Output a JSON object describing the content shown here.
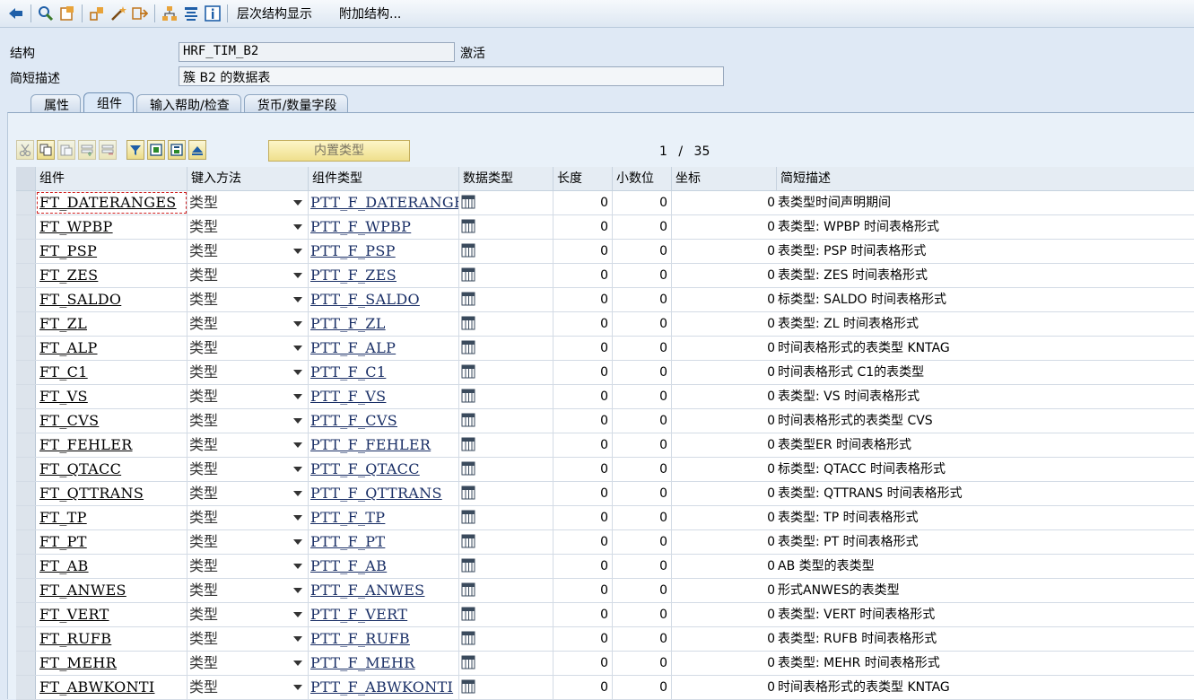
{
  "toolbar": {
    "items": [
      {
        "name": "back-icon",
        "color": "#1f5fa8"
      },
      {
        "name": "display-change-icon",
        "color": "#3a7a2a"
      },
      {
        "name": "activate-icon",
        "color": "#c0751b"
      },
      {
        "name": "where-used-icon",
        "color": "#c0751b"
      },
      {
        "name": "magic-wand-icon",
        "color": "#c0751b"
      },
      {
        "name": "object-list-icon",
        "color": "#c0751b"
      },
      {
        "name": "hierarchy-icon",
        "color": "#c0751b"
      },
      {
        "name": "other-object-icon",
        "color": "#1f5fa8"
      },
      {
        "name": "info-icon",
        "color": "#1f5fa8"
      }
    ],
    "hierarchy_label": "层次结构显示",
    "append_label": "附加结构..."
  },
  "header": {
    "structure_label": "结构",
    "structure_value": "HRF_TIM_B2",
    "status": "激活",
    "short_desc_label": "简短描述",
    "short_desc_value": "簇 B2 的数据表"
  },
  "tabs": [
    "属性",
    "组件",
    "输入帮助/检查",
    "货币/数量字段"
  ],
  "active_tab": 1,
  "grid_toolbar": {
    "builtin_type_label": "内置类型",
    "page_current": "1",
    "page_sep": "/",
    "page_total": "35"
  },
  "columns": {
    "component": "组件",
    "method": "键入方法",
    "comp_type": "组件类型",
    "data_type": "数据类型",
    "length": "长度",
    "decimals": "小数位",
    "coordinate": "坐标",
    "short_desc": "简短描述"
  },
  "rows": [
    {
      "component": "FT_DATERANGES",
      "method": "类型",
      "comp_type": "PTT_F_DATERANGES",
      "length": "0",
      "decimals": "0",
      "coordinate": "0",
      "desc": "表类型时间声明期间"
    },
    {
      "component": "FT_WPBP",
      "method": "类型",
      "comp_type": "PTT_F_WPBP",
      "length": "0",
      "decimals": "0",
      "coordinate": "0",
      "desc": "表类型: WPBP 时间表格形式"
    },
    {
      "component": "FT_PSP",
      "method": "类型",
      "comp_type": "PTT_F_PSP",
      "length": "0",
      "decimals": "0",
      "coordinate": "0",
      "desc": "表类型: PSP 时间表格形式"
    },
    {
      "component": "FT_ZES",
      "method": "类型",
      "comp_type": "PTT_F_ZES",
      "length": "0",
      "decimals": "0",
      "coordinate": "0",
      "desc": "表类型: ZES 时间表格形式"
    },
    {
      "component": "FT_SALDO",
      "method": "类型",
      "comp_type": "PTT_F_SALDO",
      "length": "0",
      "decimals": "0",
      "coordinate": "0",
      "desc": "标类型: SALDO 时间表格形式"
    },
    {
      "component": "FT_ZL",
      "method": "类型",
      "comp_type": "PTT_F_ZL",
      "length": "0",
      "decimals": "0",
      "coordinate": "0",
      "desc": "表类型: ZL 时间表格形式"
    },
    {
      "component": "FT_ALP",
      "method": "类型",
      "comp_type": "PTT_F_ALP",
      "length": "0",
      "decimals": "0",
      "coordinate": "0",
      "desc": "时间表格形式的表类型 KNTAG"
    },
    {
      "component": "FT_C1",
      "method": "类型",
      "comp_type": "PTT_F_C1",
      "length": "0",
      "decimals": "0",
      "coordinate": "0",
      "desc": "时间表格形式 C1的表类型"
    },
    {
      "component": "FT_VS",
      "method": "类型",
      "comp_type": "PTT_F_VS",
      "length": "0",
      "decimals": "0",
      "coordinate": "0",
      "desc": "表类型: VS 时间表格形式"
    },
    {
      "component": "FT_CVS",
      "method": "类型",
      "comp_type": "PTT_F_CVS",
      "length": "0",
      "decimals": "0",
      "coordinate": "0",
      "desc": "时间表格形式的表类型 CVS"
    },
    {
      "component": "FT_FEHLER",
      "method": "类型",
      "comp_type": "PTT_F_FEHLER",
      "length": "0",
      "decimals": "0",
      "coordinate": "0",
      "desc": "表类型ER 时间表格形式"
    },
    {
      "component": "FT_QTACC",
      "method": "类型",
      "comp_type": "PTT_F_QTACC",
      "length": "0",
      "decimals": "0",
      "coordinate": "0",
      "desc": "标类型: QTACC 时间表格形式"
    },
    {
      "component": "FT_QTTRANS",
      "method": "类型",
      "comp_type": "PTT_F_QTTRANS",
      "length": "0",
      "decimals": "0",
      "coordinate": "0",
      "desc": "表类型: QTTRANS 时间表格形式"
    },
    {
      "component": "FT_TP",
      "method": "类型",
      "comp_type": "PTT_F_TP",
      "length": "0",
      "decimals": "0",
      "coordinate": "0",
      "desc": "表类型: TP 时间表格形式"
    },
    {
      "component": "FT_PT",
      "method": "类型",
      "comp_type": "PTT_F_PT",
      "length": "0",
      "decimals": "0",
      "coordinate": "0",
      "desc": "表类型: PT 时间表格形式"
    },
    {
      "component": "FT_AB",
      "method": "类型",
      "comp_type": "PTT_F_AB",
      "length": "0",
      "decimals": "0",
      "coordinate": "0",
      "desc": "AB 类型的表类型"
    },
    {
      "component": "FT_ANWES",
      "method": "类型",
      "comp_type": "PTT_F_ANWES",
      "length": "0",
      "decimals": "0",
      "coordinate": "0",
      "desc": "形式ANWES的表类型"
    },
    {
      "component": "FT_VERT",
      "method": "类型",
      "comp_type": "PTT_F_VERT",
      "length": "0",
      "decimals": "0",
      "coordinate": "0",
      "desc": "表类型: VERT 时间表格形式"
    },
    {
      "component": "FT_RUFB",
      "method": "类型",
      "comp_type": "PTT_F_RUFB",
      "length": "0",
      "decimals": "0",
      "coordinate": "0",
      "desc": "表类型: RUFB 时间表格形式"
    },
    {
      "component": "FT_MEHR",
      "method": "类型",
      "comp_type": "PTT_F_MEHR",
      "length": "0",
      "decimals": "0",
      "coordinate": "0",
      "desc": "表类型: MEHR 时间表格形式"
    },
    {
      "component": "FT_ABWKONTI",
      "method": "类型",
      "comp_type": "PTT_F_ABWKONTI",
      "length": "0",
      "decimals": "0",
      "coordinate": "0",
      "desc": "时间表格形式的表类型 KNTAG"
    }
  ]
}
